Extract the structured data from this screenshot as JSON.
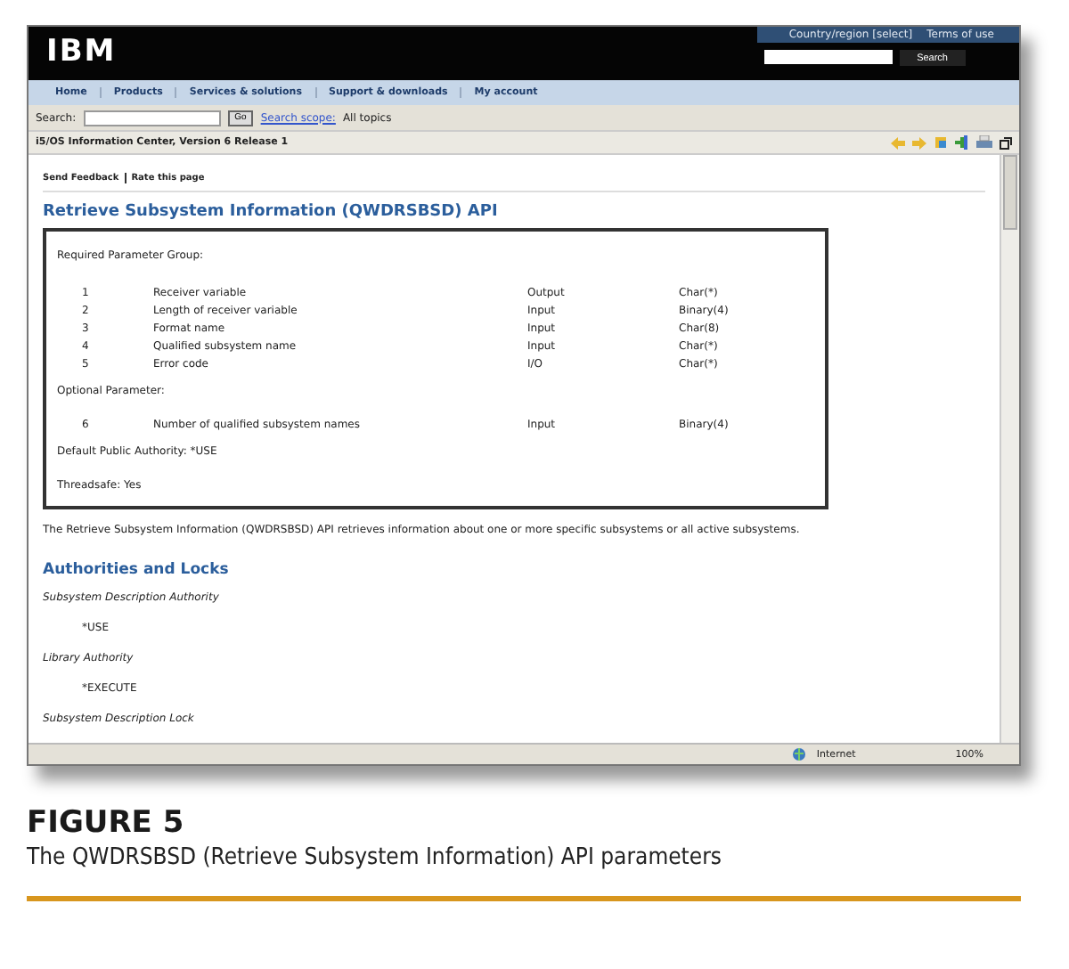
{
  "header": {
    "logo": "IBM",
    "links": [
      "Country/region [select]",
      "Terms of use"
    ],
    "search_button": "Search"
  },
  "nav": [
    "Home",
    "Products",
    "Services & solutions",
    "Support & downloads",
    "My account"
  ],
  "search_bar": {
    "label": "Search:",
    "go": "Go",
    "scope_link": "Search scope:",
    "scope_value": "All topics"
  },
  "toolbar": {
    "title": "i5/OS Information Center, Version 6 Release 1"
  },
  "feedback_links": [
    "Send Feedback",
    "Rate this page"
  ],
  "page_title": "Retrieve Subsystem Information (QWDRSBSD) API",
  "parameter_box": {
    "required_heading": "Required Parameter Group:",
    "required": [
      {
        "num": "1",
        "name": "Receiver variable",
        "usage": "Output",
        "type": "Char(*)"
      },
      {
        "num": "2",
        "name": "Length of receiver variable",
        "usage": "Input",
        "type": "Binary(4)"
      },
      {
        "num": "3",
        "name": "Format name",
        "usage": "Input",
        "type": "Char(8)"
      },
      {
        "num": "4",
        "name": "Qualified subsystem name",
        "usage": "Input",
        "type": "Char(*)"
      },
      {
        "num": "5",
        "name": "Error code",
        "usage": "I/O",
        "type": "Char(*)"
      }
    ],
    "optional_heading": "Optional Parameter:",
    "optional": [
      {
        "num": "6",
        "name": "Number of qualified subsystem names",
        "usage": "Input",
        "type": "Binary(4)"
      }
    ],
    "authority": "Default Public Authority: *USE",
    "threadsafe": "Threadsafe: Yes"
  },
  "description": "The Retrieve Subsystem Information (QWDRSBSD) API retrieves information about one or more specific subsystems or all active subsystems.",
  "section_title": "Authorities and Locks",
  "authorities": [
    {
      "kind": "term",
      "text": "Subsystem Description Authority"
    },
    {
      "kind": "value",
      "text": "*USE"
    },
    {
      "kind": "term",
      "text": "Library Authority"
    },
    {
      "kind": "value",
      "text": "*EXECUTE"
    },
    {
      "kind": "term",
      "text": "Subsystem Description Lock"
    }
  ],
  "status_bar": {
    "zone": "Internet",
    "zoom": "100%"
  },
  "figure": {
    "label": "FIGURE 5",
    "caption": "The QWDRSBSD (Retrieve Subsystem Information) API parameters"
  }
}
